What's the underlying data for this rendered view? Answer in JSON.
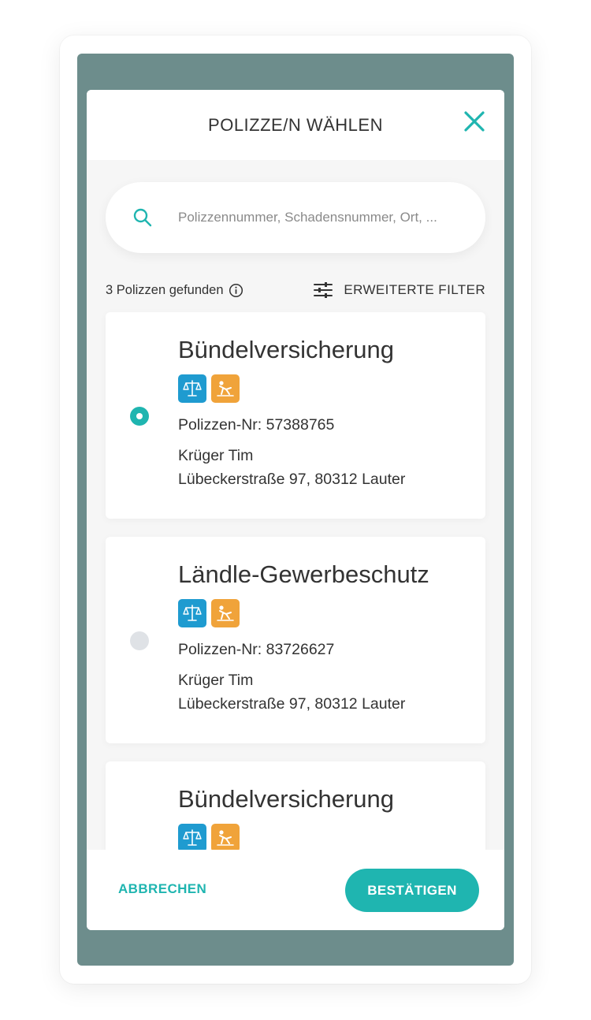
{
  "modal": {
    "title": "POLIZZE/N WÄHLEN",
    "close_icon": "close-icon",
    "accent_color": "#1fb5b0",
    "backdrop_color": "#6d8d8c"
  },
  "search": {
    "value": "",
    "placeholder": "Polizzennummer, Schadensnummer, Ort, ...",
    "icon": "search-icon"
  },
  "results": {
    "count_label": "3 Polizzen gefunden",
    "info_icon": "info-icon",
    "filter_label": "ERWEITERTE FILTER",
    "filter_icon": "sliders-icon"
  },
  "policies": [
    {
      "title": "Bündelversicherung",
      "policy_number": "Polizzen-Nr: 57388765",
      "holder": "Krüger Tim",
      "address": "Lübeckerstraße 97, 80312 Lauter",
      "selected": true,
      "badges": [
        {
          "icon": "scales-icon",
          "color": "#1f9bd0"
        },
        {
          "icon": "injury-icon",
          "color": "#f0a33a"
        }
      ]
    },
    {
      "title": "Ländle-Gewerbeschutz",
      "policy_number": "Polizzen-Nr: 83726627",
      "holder": "Krüger Tim",
      "address": "Lübeckerstraße 97, 80312 Lauter",
      "selected": false,
      "badges": [
        {
          "icon": "scales-icon",
          "color": "#1f9bd0"
        },
        {
          "icon": "injury-icon",
          "color": "#f0a33a"
        }
      ]
    },
    {
      "title": "Bündelversicherung",
      "policy_number": "",
      "holder": "",
      "address": "",
      "selected": false,
      "badges": [
        {
          "icon": "scales-icon",
          "color": "#1f9bd0"
        },
        {
          "icon": "injury-icon",
          "color": "#f0a33a"
        }
      ]
    }
  ],
  "footer": {
    "cancel_label": "ABBRECHEN",
    "confirm_label": "BESTÄTIGEN"
  }
}
